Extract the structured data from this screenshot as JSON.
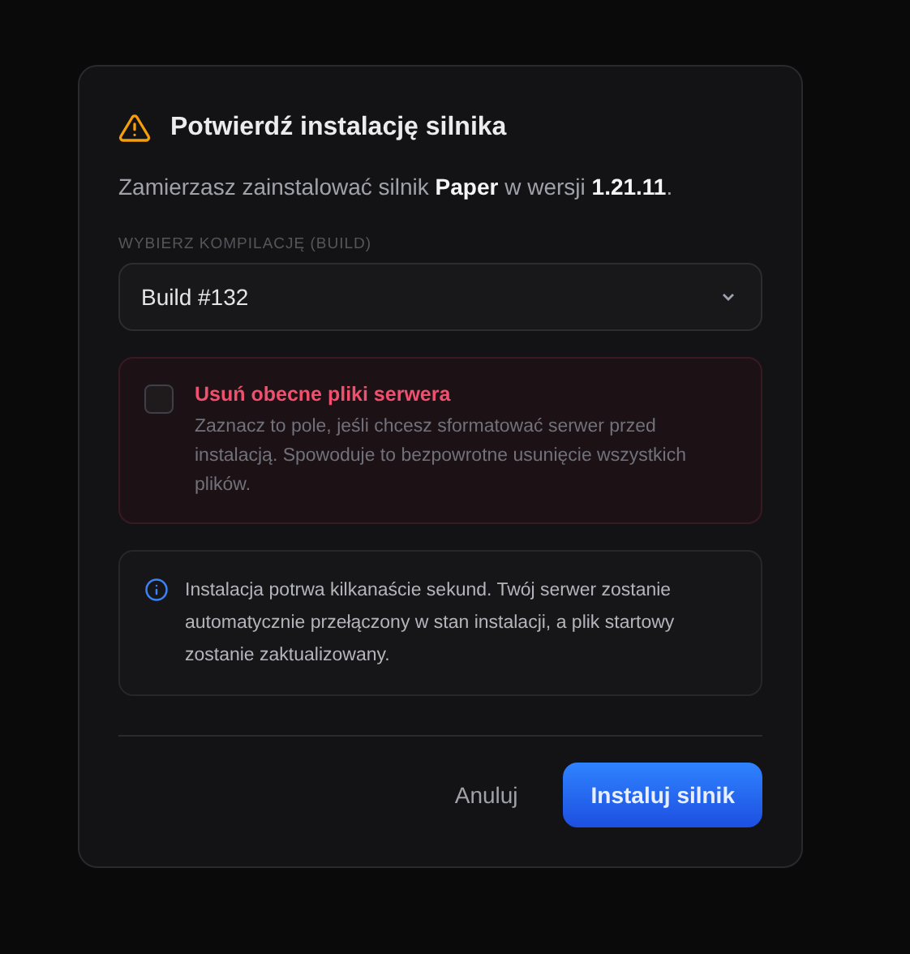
{
  "dialog": {
    "title": "Potwierdź instalację silnika",
    "intro": "Zamierzasz zainstalować silnik **Paper** w wersji **1.21.11**.",
    "build_label": "WYBIERZ KOMPILACJĘ (BUILD)",
    "build_select": {
      "value": "Build #132"
    },
    "wipe_option": {
      "checked": false,
      "title": "Usuń obecne pliki serwera",
      "description": "Zaznacz to pole, jeśli chcesz sformatować serwer przed instalacją. Spowoduje to bezpowrotne usunięcie wszystkich plików."
    },
    "info": "Instalacja potrwa kilkanaście sekund. Twój serwer zostanie automatycznie przełączony w stan instalacji, a plik startowy zostanie zaktualizowany.",
    "buttons": [
      {
        "kind": "secondary",
        "label": "Anuluj"
      },
      {
        "kind": "primary",
        "label": "Instaluj silnik"
      }
    ]
  }
}
